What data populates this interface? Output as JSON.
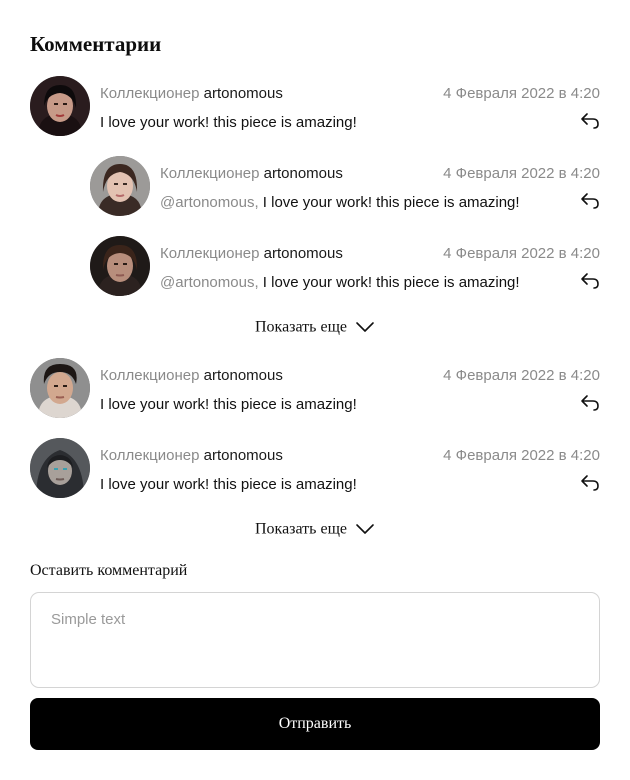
{
  "header": {
    "title": "Комментарии"
  },
  "comments": [
    {
      "role": "Коллекционер",
      "user": "artonomous",
      "date": "4 Февраля 2022 в 4:20",
      "mention": "",
      "text": "I love your work! this piece is amazing!"
    },
    {
      "role": "Коллекционер",
      "user": "artonomous",
      "date": "4 Февраля 2022 в 4:20",
      "mention": "@artonomous,",
      "text": "I love your work! this piece is amazing!"
    },
    {
      "role": "Коллекционер",
      "user": "artonomous",
      "date": "4 Февраля 2022 в 4:20",
      "mention": "@artonomous,",
      "text": "I love your work! this piece is amazing!"
    },
    {
      "role": "Коллекционер",
      "user": "artonomous",
      "date": "4 Февраля 2022 в 4:20",
      "mention": "",
      "text": "I love your work! this piece is amazing!"
    },
    {
      "role": "Коллекционер",
      "user": "artonomous",
      "date": "4 Февраля 2022 в 4:20",
      "mention": "",
      "text": "I love your work! this piece is amazing!"
    }
  ],
  "show_more": [
    "Показать еще",
    "Показать еще"
  ],
  "form": {
    "label": "Оставить комментарий",
    "placeholder": "Simple text",
    "value": "",
    "submit_label": "Отправить"
  },
  "icons": {
    "reply": "reply-arrow-icon",
    "chevron": "chevron-down-icon"
  }
}
